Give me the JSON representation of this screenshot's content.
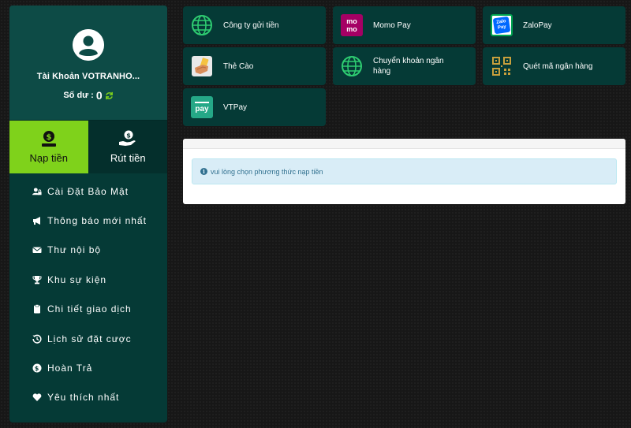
{
  "profile": {
    "account_label": "Tài Khoản VOTRANHO...",
    "balance_label": "Số dư :",
    "balance_value": "0"
  },
  "tabs": [
    {
      "label": "Nạp tiền",
      "icon": "coin-deposit-icon",
      "active": true
    },
    {
      "label": "Rút tiền",
      "icon": "hand-withdraw-icon",
      "active": false
    }
  ],
  "menu": [
    {
      "label": "Cài Đặt Bảo Mật",
      "icon": "user-lock-icon"
    },
    {
      "label": "Thông báo mới nhất",
      "icon": "megaphone-icon"
    },
    {
      "label": "Thư nội bộ",
      "icon": "envelope-icon"
    },
    {
      "label": "Khu sự kiện",
      "icon": "trophy-icon"
    },
    {
      "label": "Chi tiết giao dịch",
      "icon": "clipboard-icon"
    },
    {
      "label": "Lịch sử đặt cược",
      "icon": "history-icon"
    },
    {
      "label": "Hoàn Trả",
      "icon": "dollar-circle-icon"
    },
    {
      "label": "Yêu thích nhất",
      "icon": "heart-icon"
    }
  ],
  "payment_methods": [
    {
      "label": "Công ty gửi tiền",
      "icon": "globe-icon"
    },
    {
      "label": "Momo Pay",
      "icon": "momo-logo-icon",
      "logo_text": "mo mo"
    },
    {
      "label": "ZaloPay",
      "icon": "zalopay-logo-icon",
      "logo_text": "Zalo Pay"
    },
    {
      "label": "Thẻ Cào",
      "icon": "scratch-card-icon"
    },
    {
      "label": "Chuyển khoản ngân hàng",
      "icon": "globe-icon"
    },
    {
      "label": "Quét mã ngân hàng",
      "icon": "qr-code-icon"
    },
    {
      "label": "VTPay",
      "icon": "vtpay-logo-icon",
      "logo_text": "pay"
    }
  ],
  "notice": {
    "text": "vui lòng chọn phương thức nạp tiền"
  },
  "colors": {
    "accent_green": "#7fd21b",
    "panel_teal": "#053a36",
    "momo_pink": "#a50064",
    "globe_green": "#2ecc71",
    "qr_gold": "#c8a03c"
  }
}
